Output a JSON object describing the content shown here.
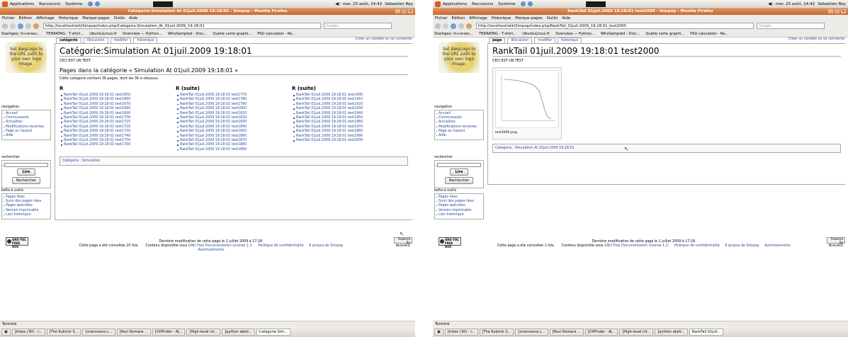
{
  "desktop": {
    "menu": [
      "Applications",
      "Raccourcis",
      "Système"
    ],
    "datetime": "mar. 25 août, 14:42",
    "user": "Sébastien Rey"
  },
  "firefox_menu": [
    "Fichier",
    "Édition",
    "Affichage",
    "Historique",
    "Marque-pages",
    "Outils",
    "Aide"
  ],
  "bookmarks": [
    "Slashgeo: In+ersec...",
    "TERRATAG - T-shirt...",
    "UbuntuLinux-fr",
    "Overview — Python...",
    "WhoSampled - Disc...",
    "Quelle carte graphi...",
    "PSU calculator - Re..."
  ],
  "search_placeholder": "Google",
  "status_text": "Terminé",
  "sidebar": {
    "logo_text": "Set $wgLogo to the URL path to your own logo image.",
    "navigation_title": "navigation",
    "navigation": [
      "Accueil",
      "Communauté",
      "Actualités",
      "Modifications récentes",
      "Page au hasard",
      "Aide"
    ],
    "search_title": "rechercher",
    "go_button": "Lire",
    "search_button": "Rechercher",
    "toolbox_title": "boîte à outils",
    "toolbox": [
      "Pages liées",
      "Suivi des pages liées",
      "Pages spéciales",
      "Version imprimable",
      "Lien historique"
    ]
  },
  "personal_link": "Créer un compte ou se connecter",
  "footer": {
    "gfdl": "GNU FDL FREE DOC LICENSE",
    "mediawiki": "Powered By MediaWiki",
    "last_modified": "Dernière modification de cette page le 1 juillet 2009 à 17:18.",
    "available_under": "Contenu disponible sous",
    "license": "GNU Free Documentation License 1.3.",
    "privacy": "Politique de confidentialité",
    "about": "À propos de Simpop",
    "disclaimers": "Avertissements"
  },
  "window1": {
    "title": "Catégorie:Simulation At 01juil.2009 19:18:01 - Simpop - Mozilla Firefox",
    "url": "http://localhost/wikiSimpop/index.php/Catégorie:Simulation_At_01juil.2009_19:18:01",
    "tabs": [
      "catégorie",
      "discussion",
      "modifier",
      "historique"
    ],
    "heading": "Catégorie:Simulation At 01juil.2009 19:18:01",
    "subtext": "CECI EST UN TEST",
    "pages_heading": "Pages dans la catégorie « Simulation At 01juil.2009 19:18:01 »",
    "count_text": "Cette catégorie contient 36 pages, dont les 36 ci-dessous.",
    "col_headers": [
      "R",
      "R (suite)",
      "R (suite)"
    ],
    "col1": [
      "RankTail 01juil.2009 19:18:01 test1650",
      "RankTail 01juil.2009 19:18:01 test1660",
      "RankTail 01juil.2009 19:18:01 test1670",
      "RankTail 01juil.2009 19:18:01 test1680",
      "RankTail 01juil.2009 19:18:01 test1690",
      "RankTail 01juil.2009 19:18:01 test1700",
      "RankTail 01juil.2009 19:18:01 test1710",
      "RankTail 01juil.2009 19:18:01 test1720",
      "RankTail 01juil.2009 19:18:01 test1730",
      "RankTail 01juil.2009 19:18:01 test1740",
      "RankTail 01juil.2009 19:18:01 test1750",
      "RankTail 01juil.2009 19:18:01 test1760"
    ],
    "col2": [
      "RankTail 01juil.2009 19:18:01 test1770",
      "RankTail 01juil.2009 19:18:01 test1780",
      "RankTail 01juil.2009 19:18:01 test1790",
      "RankTail 01juil.2009 19:18:01 test1800",
      "RankTail 01juil.2009 19:18:01 test1810",
      "RankTail 01juil.2009 19:18:01 test1820",
      "RankTail 01juil.2009 19:18:01 test1830",
      "RankTail 01juil.2009 19:18:01 test1840",
      "RankTail 01juil.2009 19:18:01 test1850",
      "RankTail 01juil.2009 19:18:01 test1860",
      "RankTail 01juil.2009 19:18:01 test1870",
      "RankTail 01juil.2009 19:18:01 test1880",
      "RankTail 01juil.2009 19:18:01 test1890"
    ],
    "col3": [
      "RankTail 01juil.2009 19:18:01 test1900",
      "RankTail 01juil.2009 19:18:01 test1910",
      "RankTail 01juil.2009 19:18:01 test1920",
      "RankTail 01juil.2009 19:18:01 test1930",
      "RankTail 01juil.2009 19:18:01 test1940",
      "RankTail 01juil.2009 19:18:01 test1950",
      "RankTail 01juil.2009 19:18:01 test1960",
      "RankTail 01juil.2009 19:18:01 test1970",
      "RankTail 01juil.2009 19:18:01 test1980",
      "RankTail 01juil.2009 19:18:01 test1990",
      "RankTail 01juil.2009 19:18:01 test2000"
    ],
    "catlinks": "Catégorie : Simulation",
    "views_text": "Cette page a été consultée 10 fois.",
    "taskbar": [
      "[Inbox (30) - r...",
      "[The Kubrick S...",
      "[scienceoss.c...",
      "[Paul Demare ...",
      "[CKFinder - Aj...",
      "[High-level int...",
      "[python abstr...",
      "Catégorie:Sim..."
    ]
  },
  "window2": {
    "title": "RankTail 01juil.2009 19:18:01 test2000 - Simpop - Mozilla Firefox",
    "url": "http://localhost/wikiSimpop/index.php/RankTail_01juil.2009_19:18:01_test2000",
    "tabs": [
      "page",
      "discussion",
      "modifier",
      "historique"
    ],
    "heading": "RankTail 01juil.2009 19:18:01 test2000",
    "subtext": "CECI EST UN TEST",
    "image_caption": "test2000.png",
    "catlinks": "Catégorie : Simulation At 01juil.2009 19:18:01",
    "views_text": "Cette page a été consultée 1 fois.",
    "taskbar": [
      "[Inbox (30) - r...",
      "[The Kubrick S...",
      "[scienceoss.c...",
      "[Paul Demare ...",
      "[CKFinder - Aj...",
      "[High-level int...",
      "[python abstr...",
      "RankTail 01juil..."
    ]
  },
  "colors": {
    "link": "#2a4a9a",
    "titlebar": "#d47a40"
  }
}
